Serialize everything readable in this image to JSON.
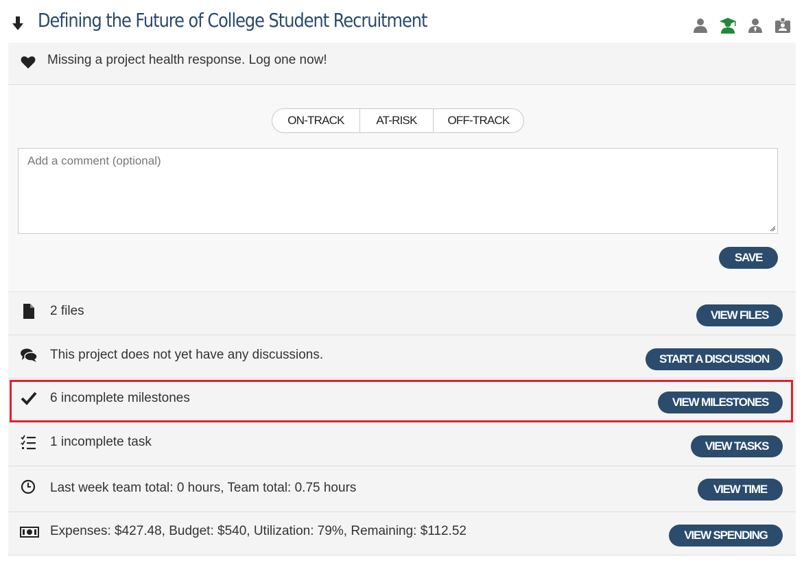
{
  "header": {
    "title": "Defining the Future of College Student Recruitment",
    "role_icons": [
      "user-icon",
      "graduate-icon",
      "advisor-icon",
      "id-badge-icon"
    ],
    "active_role_color": "#1e8a35",
    "inactive_role_color": "#777777"
  },
  "health": {
    "message": "Missing a project health response. Log one now!",
    "options": [
      "ON-TRACK",
      "AT-RISK",
      "OFF-TRACK"
    ],
    "comment_placeholder": "Add a comment (optional)",
    "save_label": "SAVE"
  },
  "rows": [
    {
      "icon": "file-icon",
      "text": "2 files",
      "button": "VIEW FILES"
    },
    {
      "icon": "comments-icon",
      "text": "This project does not yet have any discussions.",
      "button": "START A DISCUSSION"
    },
    {
      "icon": "check-icon",
      "text": "6 incomplete milestones",
      "button": "VIEW MILESTONES"
    },
    {
      "icon": "task-list-icon",
      "text": "1 incomplete task",
      "button": "VIEW TASKS"
    },
    {
      "icon": "clock-icon",
      "text": "Last week team total: 0 hours, Team total: 0.75 hours",
      "button": "VIEW TIME"
    },
    {
      "icon": "money-icon",
      "text": "Expenses: $427.48, Budget: $540, Utilization: 79%, Remaining: $112.52",
      "button": "VIEW SPENDING"
    }
  ],
  "colors": {
    "title": "#2a4a6b",
    "button_bg": "#2b4c6d",
    "highlight": "#e0202a"
  }
}
